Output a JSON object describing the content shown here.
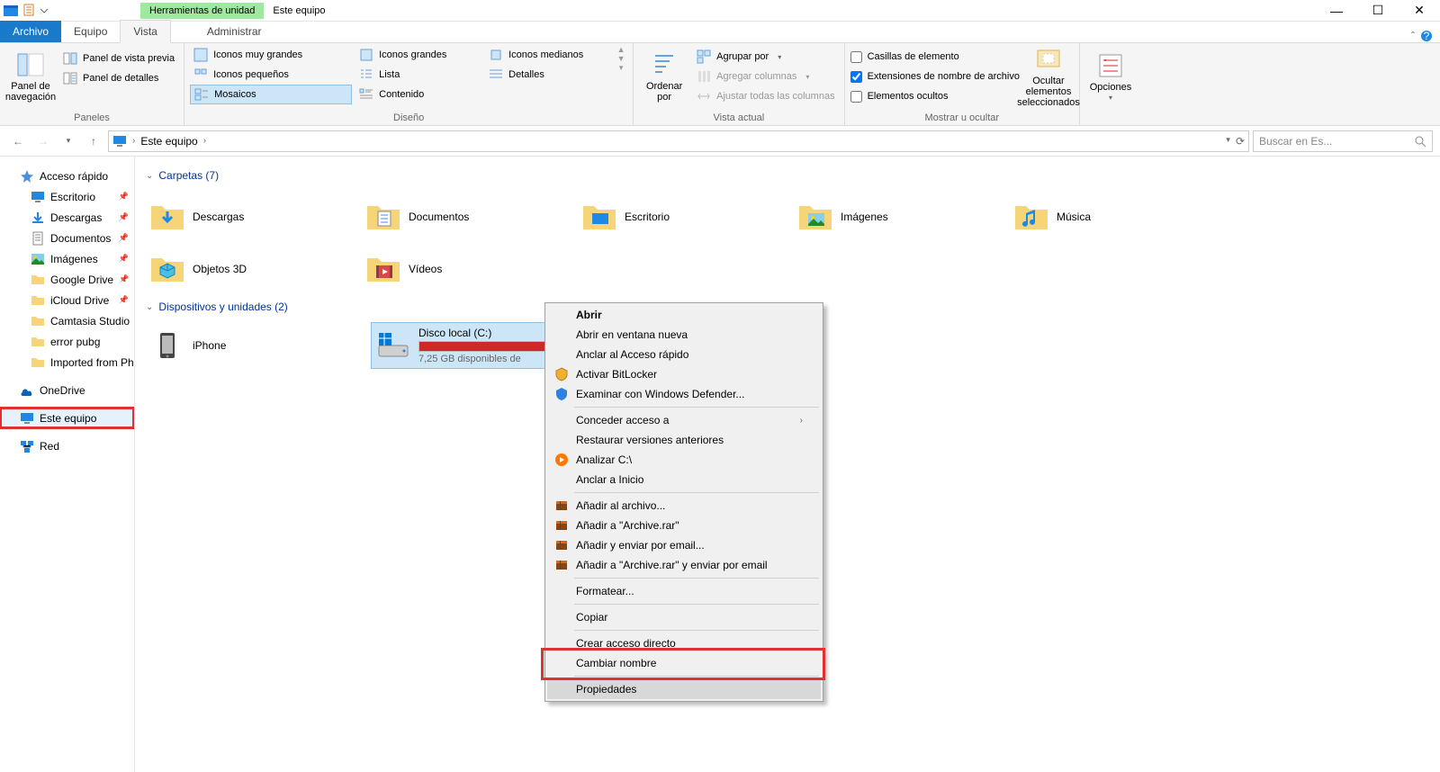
{
  "title_bar": {
    "contextual_label": "Herramientas de unidad",
    "window_title": "Este equipo"
  },
  "tabs": {
    "file": "Archivo",
    "home": "Equipo",
    "view": "Vista",
    "manage": "Administrar"
  },
  "ribbon": {
    "panels": {
      "nav_panel": "Panel de\nnavegación",
      "preview_panel": "Panel de vista previa",
      "details_panel": "Panel de detalles",
      "group": "Paneles"
    },
    "layout": {
      "xl_icons": "Iconos muy grandes",
      "l_icons": "Iconos grandes",
      "m_icons": "Iconos medianos",
      "s_icons": "Iconos pequeños",
      "list": "Lista",
      "details": "Detalles",
      "tiles": "Mosaicos",
      "content": "Contenido",
      "group": "Diseño"
    },
    "current_view": {
      "sort": "Ordenar\npor",
      "group_by": "Agrupar por",
      "add_cols": "Agregar columnas",
      "autosize": "Ajustar todas las columnas",
      "group": "Vista actual"
    },
    "show_hide": {
      "item_check": "Casillas de elemento",
      "file_ext": "Extensiones de nombre de archivo",
      "hidden": "Elementos ocultos",
      "hide_sel": "Ocultar elementos\nseleccionados",
      "group": "Mostrar u ocultar"
    },
    "options": "Opciones"
  },
  "nav": {
    "breadcrumb": "Este equipo",
    "search_placeholder": "Buscar en Es..."
  },
  "sidebar": {
    "quick_access": "Acceso rápido",
    "items": [
      {
        "label": "Escritorio",
        "pin": true
      },
      {
        "label": "Descargas",
        "pin": true
      },
      {
        "label": "Documentos",
        "pin": true
      },
      {
        "label": "Imágenes",
        "pin": true
      },
      {
        "label": "Google Drive",
        "pin": true
      },
      {
        "label": "iCloud Drive",
        "pin": true
      },
      {
        "label": "Camtasia Studio",
        "pin": false
      },
      {
        "label": "error pubg",
        "pin": false
      },
      {
        "label": "Imported from Pho",
        "pin": false
      }
    ],
    "onedrive": "OneDrive",
    "this_pc": "Este equipo",
    "network": "Red"
  },
  "content": {
    "folders_header": "Carpetas (7)",
    "folders": [
      {
        "label": "Descargas"
      },
      {
        "label": "Documentos"
      },
      {
        "label": "Escritorio"
      },
      {
        "label": "Imágenes"
      },
      {
        "label": "Música"
      },
      {
        "label": "Objetos 3D"
      },
      {
        "label": "Vídeos"
      }
    ],
    "devices_header": "Dispositivos y unidades (2)",
    "iphone": "iPhone",
    "drive": {
      "name": "Disco local (C:)",
      "sub": "7,25 GB disponibles de",
      "fill_pct": 94
    }
  },
  "context_menu": {
    "open": "Abrir",
    "open_new": "Abrir en ventana nueva",
    "pin_quick": "Anclar al Acceso rápido",
    "bitlocker": "Activar BitLocker",
    "defender": "Examinar con Windows Defender...",
    "grant_access": "Conceder acceso a",
    "restore": "Restaurar versiones anteriores",
    "analyze": "Analizar C:\\",
    "pin_start": "Anclar a Inicio",
    "add_archive": "Añadir al archivo...",
    "add_archive_rar": "Añadir a \"Archive.rar\"",
    "send_email": "Añadir y enviar por email...",
    "add_rar_email": "Añadir a \"Archive.rar\" y enviar por email",
    "format": "Formatear...",
    "copy": "Copiar",
    "shortcut": "Crear acceso directo",
    "rename": "Cambiar nombre",
    "properties": "Propiedades"
  }
}
